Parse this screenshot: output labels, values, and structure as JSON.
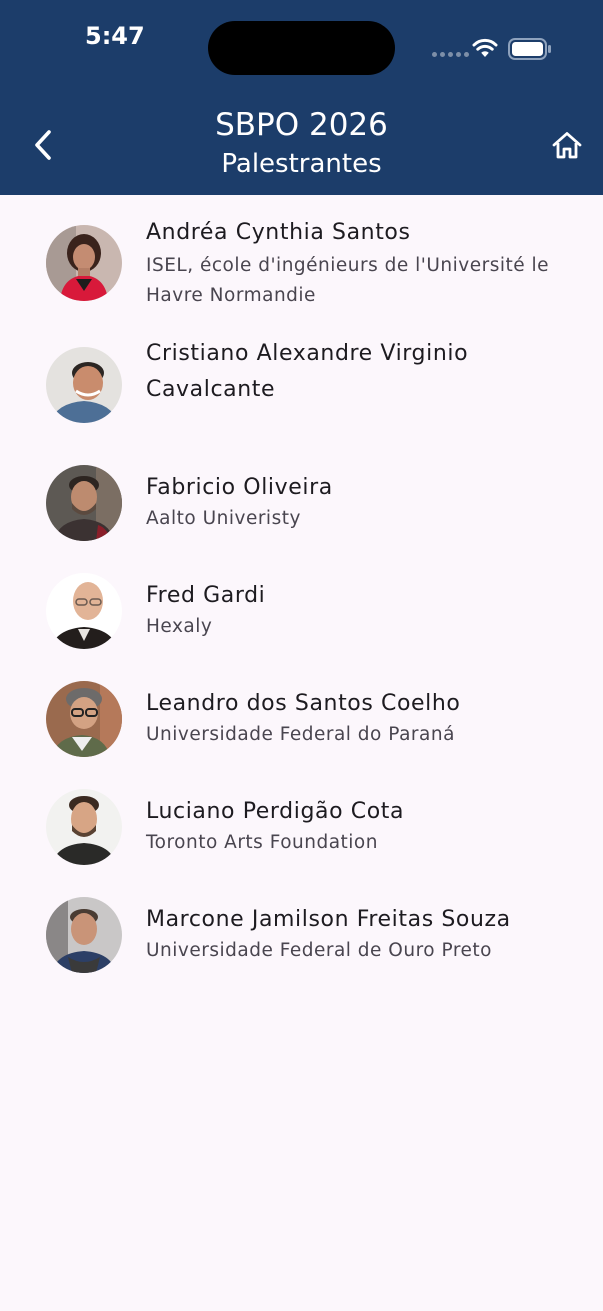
{
  "status_bar": {
    "time": "5:47"
  },
  "header": {
    "title": "SBPO 2026",
    "subtitle": "Palestrantes",
    "back_icon": "chevron-left-icon",
    "home_icon": "home-icon",
    "background": "#1c3d6a"
  },
  "speakers": [
    {
      "name": "Andréa Cynthia Santos",
      "affiliation": "ISEL, école d'ingénieurs de l'Université le Havre Normandie"
    },
    {
      "name": "Cristiano Alexandre Virginio Cavalcante",
      "affiliation": ""
    },
    {
      "name": "Fabricio Oliveira",
      "affiliation": "Aalto Univeristy"
    },
    {
      "name": "Fred Gardi",
      "affiliation": "Hexaly"
    },
    {
      "name": "Leandro dos Santos Coelho",
      "affiliation": "Universidade Federal do Paraná"
    },
    {
      "name": "Luciano Perdigão Cota",
      "affiliation": "Toronto Arts Foundation"
    },
    {
      "name": "Marcone Jamilson Freitas Souza",
      "affiliation": "Universidade Federal de Ouro Preto"
    }
  ]
}
